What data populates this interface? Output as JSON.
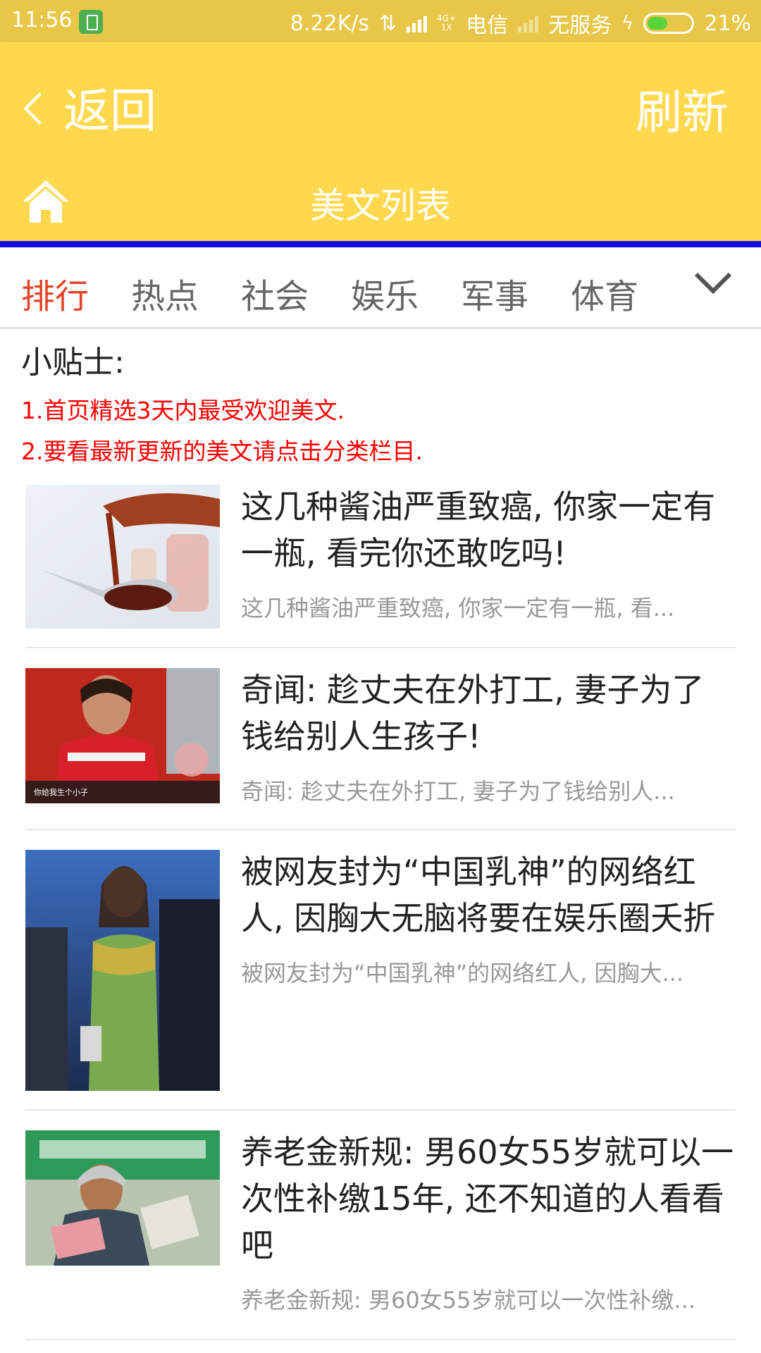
{
  "statusbar": {
    "time": "11:56",
    "speed": "8.22K/s",
    "net_top": "4G+",
    "net_bottom": "1X",
    "carrier1": "电信",
    "carrier2": "无服务",
    "battery_pct": "21%",
    "battery_level": 0.21
  },
  "nav": {
    "back_label": "返回",
    "refresh_label": "刷新",
    "page_title": "美文列表"
  },
  "tabs": [
    "排行",
    "热点",
    "社会",
    "娱乐",
    "军事",
    "体育"
  ],
  "active_tab": 0,
  "tips": {
    "title": "小贴士:",
    "lines": [
      "1.首页精选3天内最受欢迎美文.",
      "2.要看最新更新的美文请点击分类栏目."
    ]
  },
  "colors": {
    "header": "#ffd84d",
    "statusbar": "#e8c748",
    "accent": "#e4432a",
    "tip_red": "#ff0000",
    "divider_blue": "#1010e0"
  },
  "articles": [
    {
      "title": "这几种酱油严重致癌, 你家一定有一瓶, 看完你还敢吃吗!",
      "summary": "这几种酱油严重致癌, 你家一定有一瓶, 看...",
      "image": "soy-sauce-spoon"
    },
    {
      "title": "奇闻: 趁丈夫在外打工, 妻子为了钱给别人生孩子!",
      "summary": "奇闻: 趁丈夫在外打工, 妻子为了钱给别人...",
      "image": "woman-red-jacket",
      "caption": "你给我生个小子"
    },
    {
      "title": "被网友封为“中国乳神”的网络红人, 因胸大无脑将要在娱乐圈夭折",
      "summary": "被网友封为“中国乳神”的网络红人, 因胸大...",
      "image": "woman-green-dress"
    },
    {
      "title": "养老金新规: 男60女55岁就可以一次性补缴15年, 还不知道的人看看吧",
      "summary": "养老金新规: 男60女55岁就可以一次性补缴...",
      "image": "elderly-woman-cash"
    }
  ]
}
